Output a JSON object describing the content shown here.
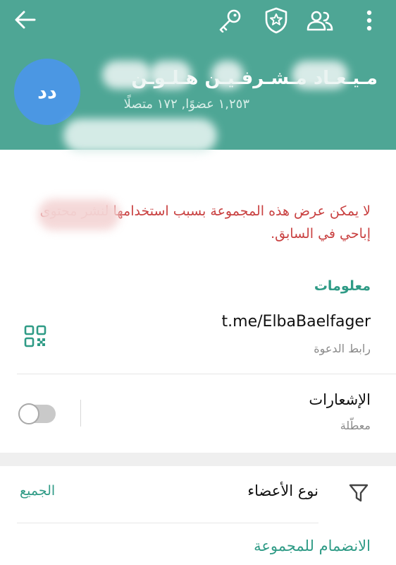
{
  "header": {
    "avatar_initials": "دد",
    "group_name": "مـيـعـاد مـشـرفـيـن هـلـوـن",
    "stats": "١,٢٥٣ عضوًا, ١٧٢ متصلًا",
    "color": "#4ea695",
    "icons": [
      "back-arrow-icon",
      "key-icon",
      "shield-star-icon",
      "people-icon",
      "more-vert-icon"
    ]
  },
  "notice": {
    "text": "لا يمكن عرض هذه المجموعة بسبب استخدامها لنشر محتوى إباحي في السابق.",
    "color": "#c94141"
  },
  "info": {
    "section_title": "معلومات",
    "invite_link": "t.me/ElbaBaelfager",
    "invite_link_label": "رابط الدعوة"
  },
  "notifications": {
    "label": "الإشعارات",
    "status": "معطّلة",
    "enabled": false
  },
  "members": {
    "filter_label": "نوع الأعضاء",
    "filter_value": "الجميع"
  },
  "join_button": "الانضمام للمجموعة",
  "accent_color": "#2f9b86"
}
